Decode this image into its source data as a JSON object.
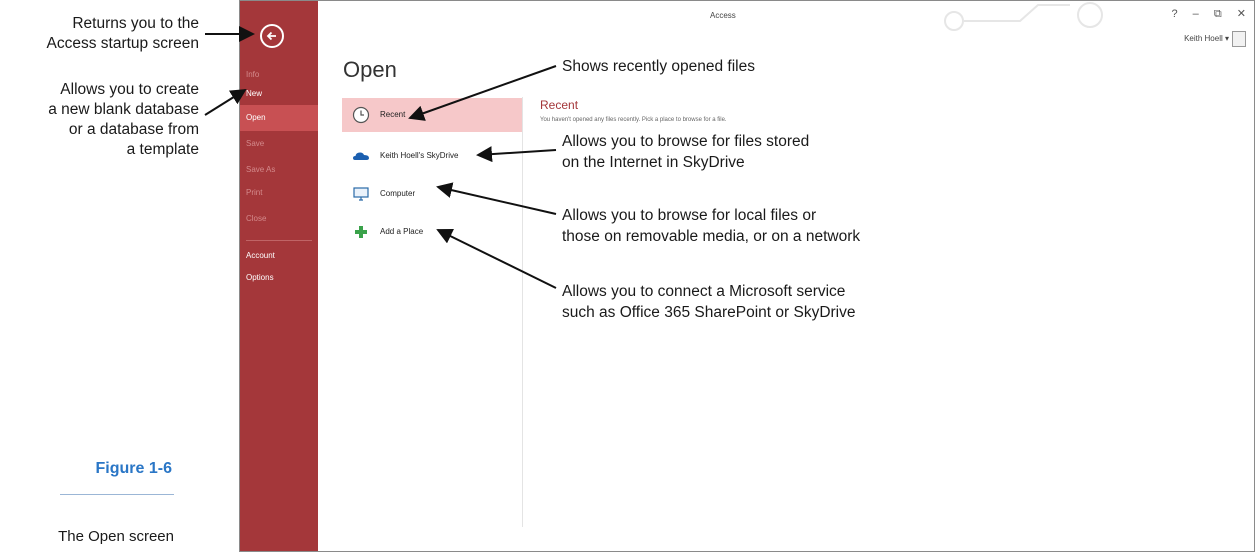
{
  "callouts": {
    "back": [
      "Returns you to the",
      "Access startup screen"
    ],
    "new": [
      "Allows you to create",
      "a new blank database",
      "or a database from",
      "a template"
    ],
    "recent": "Shows recently opened files",
    "skydrive": [
      "Allows you to browse for files stored",
      "on the Internet in SkyDrive"
    ],
    "computer": [
      "Allows you to browse for local files or",
      "those on removable media, or on a network"
    ],
    "add_place": [
      "Allows you to connect a Microsoft service",
      "such as Office 365 SharePoint or SkyDrive"
    ]
  },
  "figure": {
    "label": "Figure 1-6",
    "caption": "The Open screen"
  },
  "window": {
    "title": "Access",
    "user": "Keith Hoell",
    "controls": [
      "?",
      "–",
      "⧉",
      "✕"
    ]
  },
  "backstage": {
    "items": [
      {
        "label": "Info",
        "state": "dim"
      },
      {
        "label": "New",
        "state": "normal"
      },
      {
        "label": "Open",
        "state": "active"
      },
      {
        "label": "Save",
        "state": "dim"
      },
      {
        "label": "Save As",
        "state": "dim"
      },
      {
        "label": "Print",
        "state": "dim"
      },
      {
        "label": "Close",
        "state": "dim"
      },
      {
        "label": "Account",
        "state": "normal"
      },
      {
        "label": "Options",
        "state": "normal"
      }
    ]
  },
  "open": {
    "heading": "Open",
    "places": [
      {
        "label": "Recent",
        "icon": "clock-icon",
        "selected": true
      },
      {
        "label": "Keith Hoell's SkyDrive",
        "icon": "cloud-icon",
        "selected": false
      },
      {
        "label": "Computer",
        "icon": "computer-icon",
        "selected": false
      },
      {
        "label": "Add a Place",
        "icon": "plus-icon",
        "selected": false
      }
    ],
    "recent_heading": "Recent",
    "recent_message": "You haven't opened any files recently. Pick a place to browse for a file."
  },
  "colors": {
    "backstage": "#a4373a",
    "selected_place": "#f6c8c9",
    "figure_label": "#2a76c6"
  }
}
